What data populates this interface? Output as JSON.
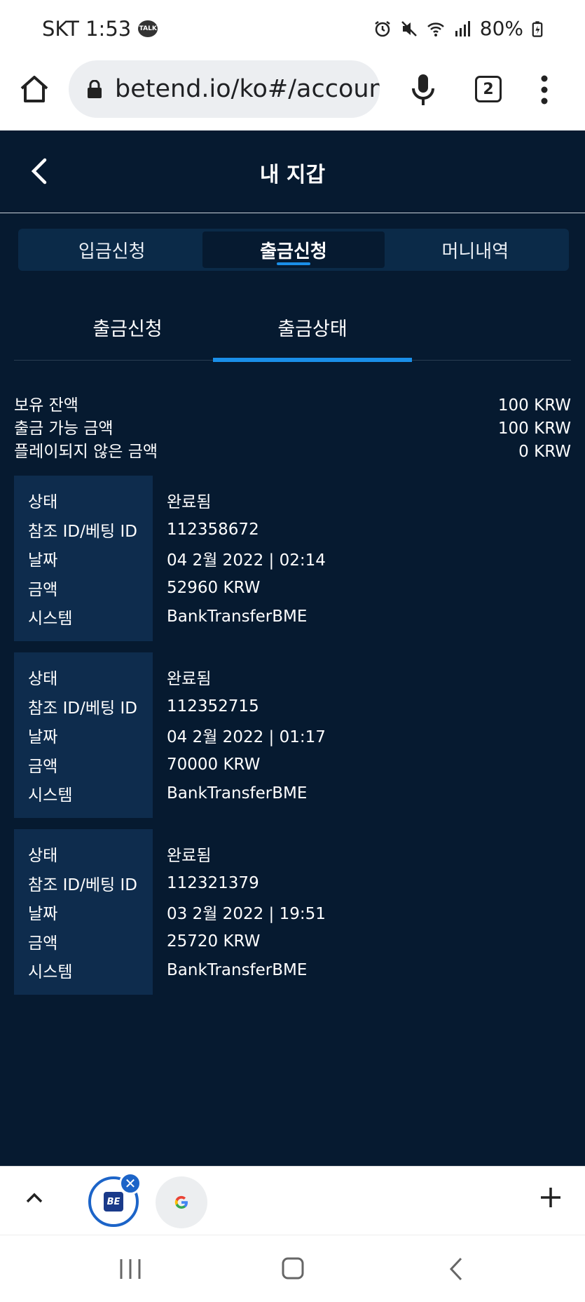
{
  "status": {
    "carrier_time": "SKT 1:53",
    "talk_icon": "TALK",
    "battery": "80%"
  },
  "browser": {
    "url": "betend.io/ko#/account",
    "tab_count": "2"
  },
  "header": {
    "title": "내 지갑"
  },
  "main_tabs": [
    {
      "label": "입금신청",
      "active": false
    },
    {
      "label": "출금신청",
      "active": true
    },
    {
      "label": "머니내역",
      "active": false
    }
  ],
  "sub_tabs": [
    {
      "label": "출금신청",
      "active": false
    },
    {
      "label": "출금상태",
      "active": true
    }
  ],
  "balances": [
    {
      "label": "보유 잔액",
      "value": "100 KRW"
    },
    {
      "label": "출금 가능 금액",
      "value": "100 KRW"
    },
    {
      "label": "플레이되지 않은 금액",
      "value": "0 KRW"
    }
  ],
  "record_labels": {
    "status": "상태",
    "ref_id": "참조 ID/베팅 ID",
    "date": "날짜",
    "amount": "금액",
    "system": "시스템"
  },
  "records": [
    {
      "status": "완료됨",
      "ref_id": "112358672",
      "date": "04 2월 2022 | 02:14",
      "amount": "52960 KRW",
      "system": "BankTransferBME"
    },
    {
      "status": "완료됨",
      "ref_id": "112352715",
      "date": "04 2월 2022 | 01:17",
      "amount": "70000 KRW",
      "system": "BankTransferBME"
    },
    {
      "status": "완료됨",
      "ref_id": "112321379",
      "date": "03 2월 2022 | 19:51",
      "amount": "25720 KRW",
      "system": "BankTransferBME"
    }
  ],
  "bottom_tabs": {
    "be_logo": "BE"
  },
  "colors": {
    "app_bg": "#061a30",
    "accent": "#1a8fe8",
    "label_bg": "#0e2c4d"
  }
}
